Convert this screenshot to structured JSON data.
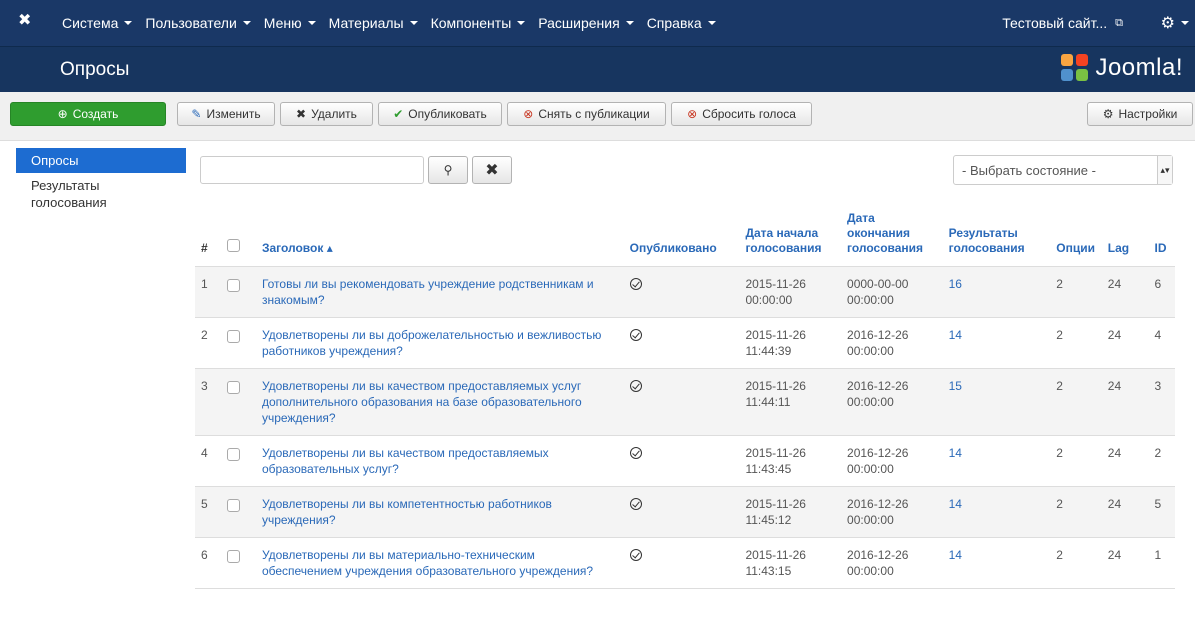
{
  "navbar": {
    "menu": [
      "Система",
      "Пользователи",
      "Меню",
      "Материалы",
      "Компоненты",
      "Расширения",
      "Справка"
    ],
    "site_link": "Тестовый сайт..."
  },
  "subhead": {
    "title": "Опросы",
    "brand": "Joomla!"
  },
  "toolbar": {
    "create": "Создать",
    "edit": "Изменить",
    "delete": "Удалить",
    "publish": "Опубликовать",
    "unpublish": "Снять с публикации",
    "reset_votes": "Сбросить голоса",
    "options": "Настройки"
  },
  "sidebar": {
    "items": [
      "Опросы",
      "Результаты голосования"
    ]
  },
  "filters": {
    "search_value": "",
    "state_select": "- Выбрать состояние -"
  },
  "table": {
    "columns": {
      "num": "#",
      "title": "Заголовок",
      "published": "Опубликовано",
      "start_date": "Дата начала голосования",
      "end_date": "Дата окончания голосования",
      "results": "Результаты голосования",
      "options": "Опции",
      "lag": "Lag",
      "id": "ID"
    },
    "rows": [
      {
        "num": "1",
        "title": "Готовы ли вы рекомендовать учреждение родственникам и знакомым?",
        "start": "2015-11-26 00:00:00",
        "end": "0000-00-00 00:00:00",
        "votes": "16",
        "options": "2",
        "lag": "24",
        "id": "6"
      },
      {
        "num": "2",
        "title": "Удовлетворены ли вы доброжелательностью и вежливостью работников учреждения?",
        "start": "2015-11-26 11:44:39",
        "end": "2016-12-26 00:00:00",
        "votes": "14",
        "options": "2",
        "lag": "24",
        "id": "4"
      },
      {
        "num": "3",
        "title": "Удовлетворены ли вы качеством предоставляемых услуг дополнительного образования на базе образовательного учреждения?",
        "start": "2015-11-26 11:44:11",
        "end": "2016-12-26 00:00:00",
        "votes": "15",
        "options": "2",
        "lag": "24",
        "id": "3"
      },
      {
        "num": "4",
        "title": "Удовлетворены ли вы качеством предоставляемых образовательных услуг?",
        "start": "2015-11-26 11:43:45",
        "end": "2016-12-26 00:00:00",
        "votes": "14",
        "options": "2",
        "lag": "24",
        "id": "2"
      },
      {
        "num": "5",
        "title": "Удовлетворены ли вы компетентностью работников учреждения?",
        "start": "2015-11-26 11:45:12",
        "end": "2016-12-26 00:00:00",
        "votes": "14",
        "options": "2",
        "lag": "24",
        "id": "5"
      },
      {
        "num": "6",
        "title": "Удовлетворены ли вы материально-техническим обеспечением учреждения образовательного учреждения?",
        "start": "2015-11-26 11:43:15",
        "end": "2016-12-26 00:00:00",
        "votes": "14",
        "options": "2",
        "lag": "24",
        "id": "1"
      }
    ]
  },
  "colors": {
    "navbar": "#1a3867",
    "accent_green": "#2f9d2f",
    "link_blue": "#2a69b8",
    "active_blue": "#1d6cd1"
  }
}
